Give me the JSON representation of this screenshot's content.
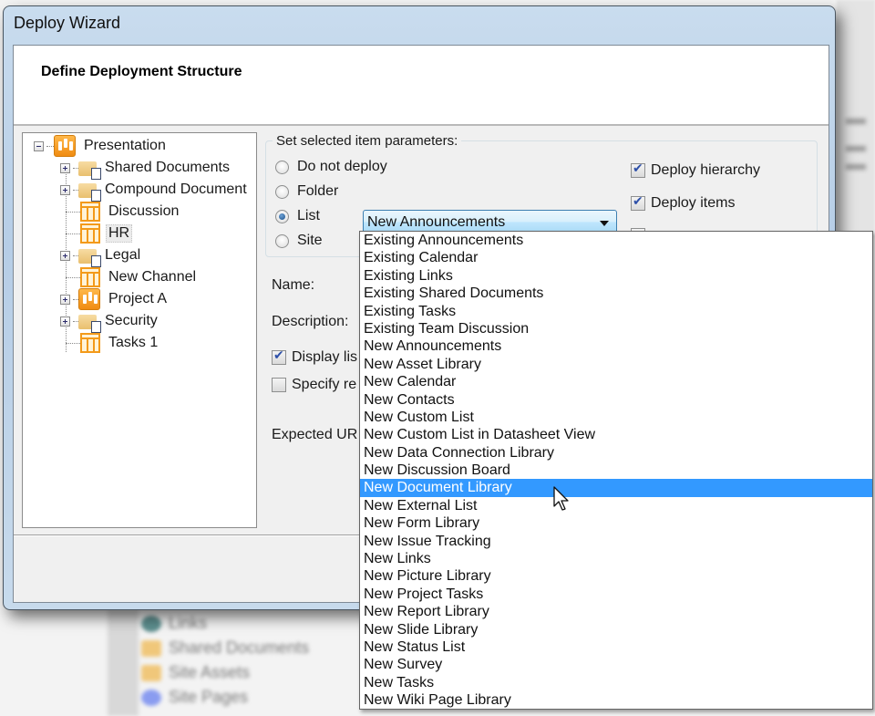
{
  "window": {
    "title": "Deploy Wizard"
  },
  "header": {
    "title": "Define Deployment Structure"
  },
  "tree": {
    "root": {
      "label": "Presentation",
      "icon": "site-icon",
      "expanded": true
    },
    "children": [
      {
        "label": "Shared Documents",
        "icon": "document-library-icon",
        "expandable": true
      },
      {
        "label": "Compound Document",
        "icon": "document-library-icon",
        "expandable": true
      },
      {
        "label": "Discussion",
        "icon": "list-icon",
        "expandable": false
      },
      {
        "label": "HR",
        "icon": "list-icon",
        "expandable": false,
        "selected": true
      },
      {
        "label": "Legal",
        "icon": "document-library-icon",
        "expandable": true
      },
      {
        "label": "New Channel",
        "icon": "list-icon",
        "expandable": false
      },
      {
        "label": "Project A",
        "icon": "site-icon",
        "expandable": true
      },
      {
        "label": "Security",
        "icon": "document-library-icon",
        "expandable": true
      },
      {
        "label": "Tasks 1",
        "icon": "list-icon",
        "expandable": false
      }
    ]
  },
  "params": {
    "legend": "Set selected item parameters:",
    "radios": [
      {
        "label": "Do not deploy",
        "checked": false
      },
      {
        "label": "Folder",
        "checked": false
      },
      {
        "label": "List",
        "checked": true
      },
      {
        "label": "Site",
        "checked": false
      }
    ],
    "checkboxes": [
      {
        "label": "Deploy hierarchy",
        "checked": true
      },
      {
        "label": "Deploy items",
        "checked": true
      }
    ],
    "list_type": {
      "selected": "New Announcements",
      "options": [
        "Existing Announcements",
        "Existing Calendar",
        "Existing Links",
        "Existing Shared Documents",
        "Existing Tasks",
        "Existing Team Discussion",
        "New Announcements",
        "New Asset Library",
        "New Calendar",
        "New Contacts",
        "New Custom List",
        "New Custom List in Datasheet View",
        "New Data Connection Library",
        "New Discussion Board",
        "New Document Library",
        "New External List",
        "New Form Library",
        "New Issue Tracking",
        "New Links",
        "New Picture Library",
        "New Project Tasks",
        "New Report Library",
        "New Slide Library",
        "New Status List",
        "New Survey",
        "New Tasks",
        "New Wiki Page Library"
      ],
      "highlighted": "New Document Library"
    }
  },
  "fields": {
    "name_label": "Name:",
    "description_label": "Description:",
    "display_list_label": "Display lis",
    "display_list_checked": true,
    "specify_label": "Specify re",
    "specify_checked": false,
    "expected_url_label": "Expected UR"
  },
  "background": {
    "items": [
      "Links",
      "Shared Documents",
      "Site Assets",
      "Site Pages"
    ]
  },
  "colors": {
    "highlight": "#3399ff",
    "site_icon": "#f08c12",
    "title_bar": "#b6cde6"
  }
}
